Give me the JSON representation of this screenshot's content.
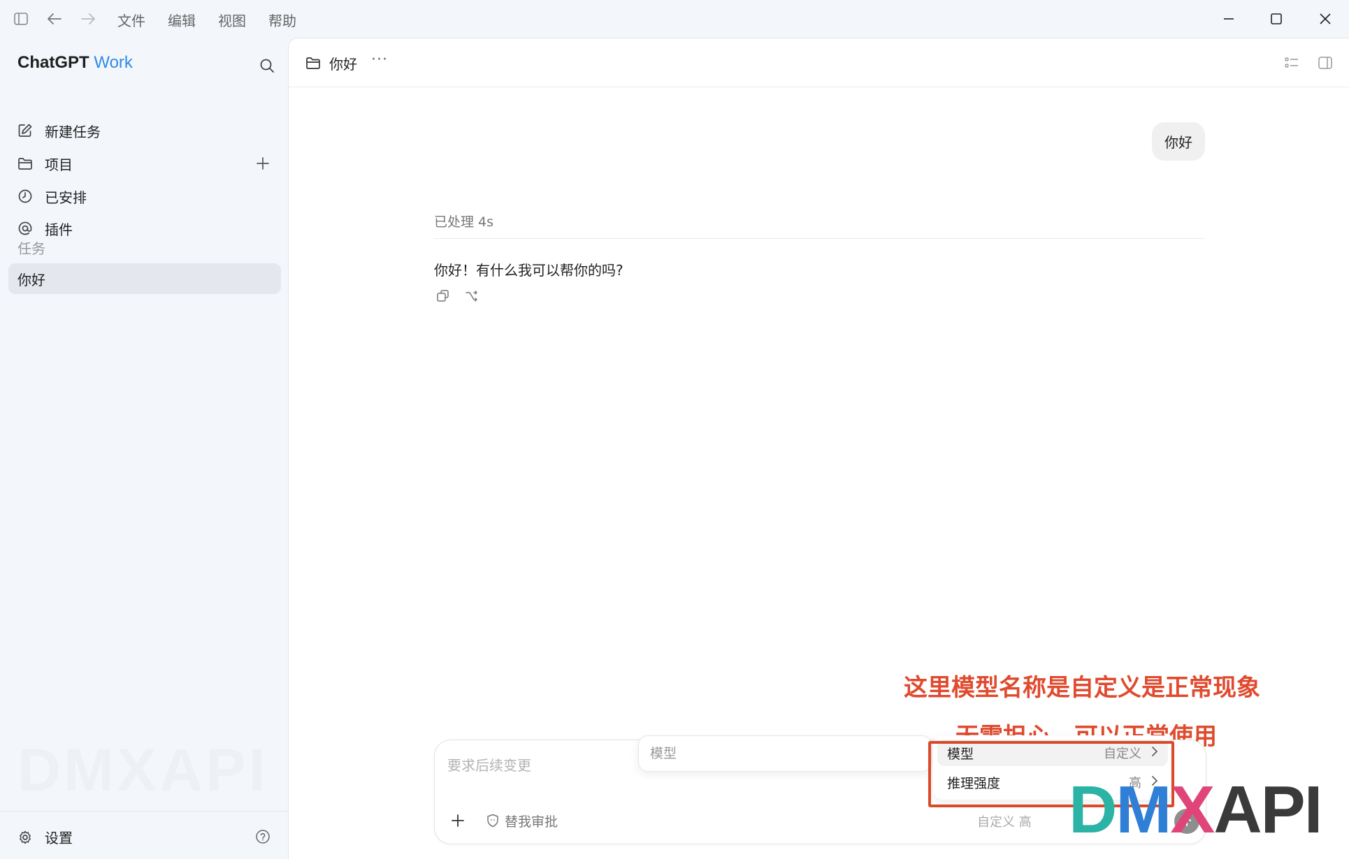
{
  "titlebar": {
    "menus": [
      "文件",
      "编辑",
      "视图",
      "帮助"
    ]
  },
  "sidebar": {
    "brand_main": "ChatGPT",
    "brand_accent": "Work",
    "nav": [
      {
        "label": "新建任务",
        "icon": "edit-icon"
      },
      {
        "label": "项目",
        "icon": "folder-icon"
      },
      {
        "label": "已安排",
        "icon": "clock-icon"
      },
      {
        "label": "插件",
        "icon": "at-icon"
      }
    ],
    "section_title": "任务",
    "tasks": [
      {
        "label": "你好",
        "selected": true
      }
    ],
    "watermark": "DMXAPI",
    "settings_label": "设置"
  },
  "main": {
    "header_title": "你好",
    "header_more": "···",
    "user_message": "你好",
    "processed_text": "已处理 4s",
    "assistant_reply": "你好！有什么我可以帮你的吗?"
  },
  "composer": {
    "placeholder": "要求后续变更",
    "approve_label": "替我审批",
    "model_tag": "自定义 高"
  },
  "popup": {
    "search_placeholder": "模型",
    "rows": [
      {
        "label": "模型",
        "value": "自定义"
      },
      {
        "label": "推理强度",
        "value": "高"
      }
    ]
  },
  "annotation": {
    "line1": "这里模型名称是自定义是正常现象",
    "line2": "无需担心，可以正常使用"
  },
  "logo": {
    "d": "D",
    "m": "M",
    "x": "X",
    "api": "API"
  },
  "colors": {
    "accent": "#2f8be6",
    "annotation": "#e04a2e",
    "highlight_border": "#d94a2b",
    "sidebar_bg": "#f3f6fb"
  }
}
